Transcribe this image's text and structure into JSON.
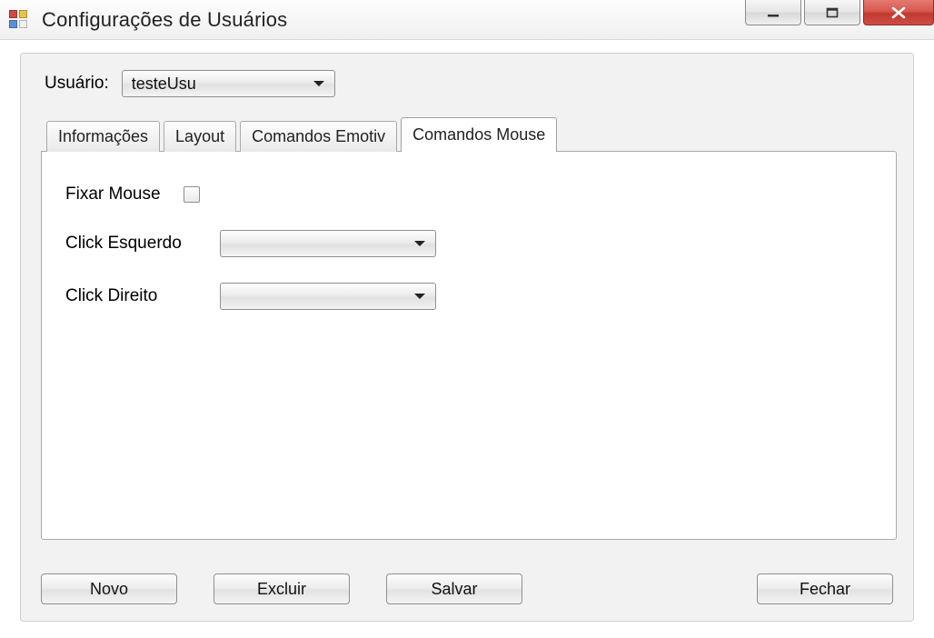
{
  "window": {
    "title": "Configurações de Usuários"
  },
  "header": {
    "user_label": "Usuário:",
    "user_value": "testeUsu"
  },
  "tabs": {
    "items": [
      {
        "label": "Informações",
        "active": false
      },
      {
        "label": "Layout",
        "active": false
      },
      {
        "label": "Comandos Emotiv",
        "active": false
      },
      {
        "label": "Comandos Mouse",
        "active": true
      }
    ]
  },
  "mouse_tab": {
    "fix_mouse_label": "Fixar Mouse",
    "fix_mouse_checked": false,
    "left_click_label": "Click Esquerdo",
    "left_click_value": "",
    "right_click_label": "Click Direito",
    "right_click_value": ""
  },
  "buttons": {
    "novo": "Novo",
    "excluir": "Excluir",
    "salvar": "Salvar",
    "fechar": "Fechar"
  }
}
